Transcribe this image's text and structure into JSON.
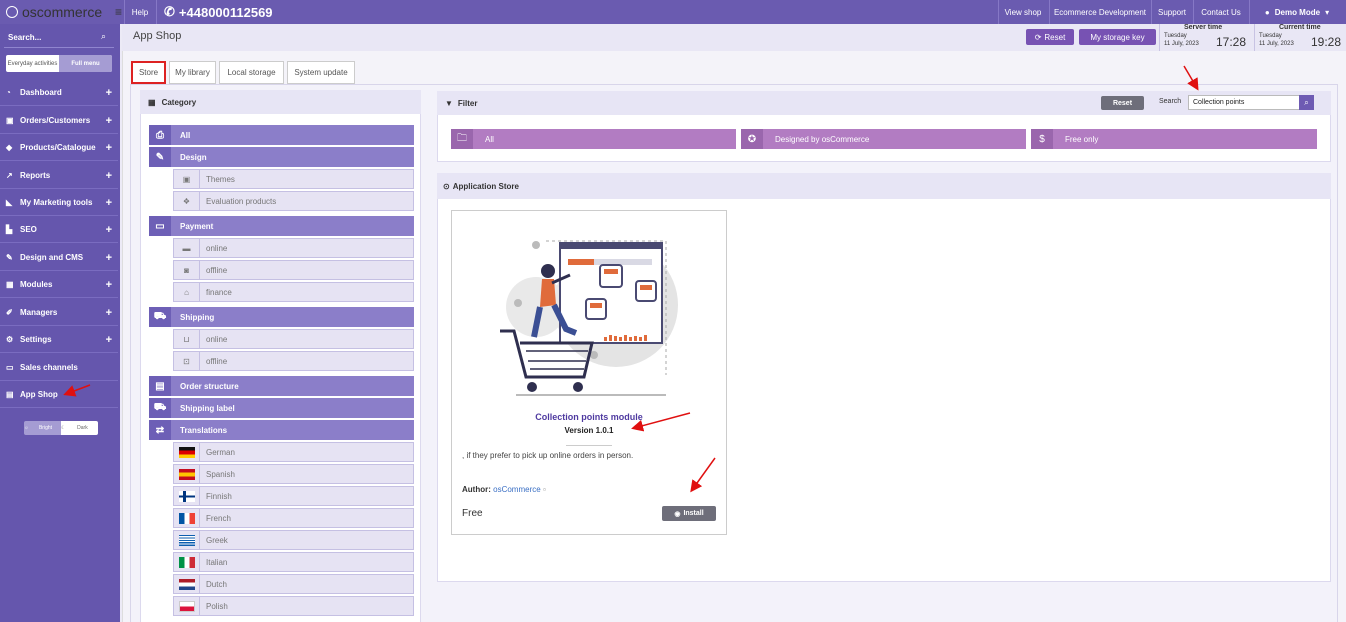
{
  "app": {
    "logo": "oscommerce",
    "help": "Help",
    "phone": "+448000112569"
  },
  "topnav": {
    "view_shop": "View shop",
    "ecommerce_dev": "Ecommerce Development",
    "support": "Support",
    "contact_us": "Contact Us",
    "demo_mode": "Demo Mode"
  },
  "sidebar": {
    "search_placeholder": "Search...",
    "toggle": {
      "everyday": "Everyday activities",
      "full": "Full menu"
    },
    "items": [
      {
        "label": "Dashboard",
        "icon": "dashboard-icon",
        "glyph": "◔"
      },
      {
        "label": "Orders/Customers",
        "icon": "cart-icon",
        "glyph": "▣"
      },
      {
        "label": "Products/Catalogue",
        "icon": "tag-icon",
        "glyph": "◆"
      },
      {
        "label": "Reports",
        "icon": "chart-icon",
        "glyph": "↗"
      },
      {
        "label": "My Marketing tools",
        "icon": "megaphone-icon",
        "glyph": "◣"
      },
      {
        "label": "SEO",
        "icon": "bars-icon",
        "glyph": "▙"
      },
      {
        "label": "Design and CMS",
        "icon": "brush-icon",
        "glyph": "✎"
      },
      {
        "label": "Modules",
        "icon": "cubes-icon",
        "glyph": "▦"
      },
      {
        "label": "Managers",
        "icon": "pencil-icon",
        "glyph": "✐"
      },
      {
        "label": "Settings",
        "icon": "gears-icon",
        "glyph": "⚙"
      },
      {
        "label": "Sales channels",
        "icon": "monitor-icon",
        "glyph": "▭"
      },
      {
        "label": "App Shop",
        "icon": "shop-icon",
        "glyph": "▤"
      }
    ],
    "theme": {
      "bright": "Bright",
      "dark": "Dark"
    }
  },
  "header": {
    "title": "App Shop",
    "reset": "Reset",
    "storage_key": "My storage key",
    "server_time": {
      "label": "Server time",
      "day": "Tuesday",
      "date": "11 July, 2023",
      "time": "17:28"
    },
    "current_time": {
      "label": "Current time",
      "day": "Tuesday",
      "date": "11 July, 2023",
      "time": "19:28"
    }
  },
  "tabs": [
    "Store",
    "My library",
    "Local storage",
    "System update"
  ],
  "category": {
    "title": "Category",
    "all": "All",
    "design": "Design",
    "themes": "Themes",
    "evaluation": "Evaluation products",
    "payment": "Payment",
    "pay_online": "online",
    "pay_offline": "offline",
    "finance": "finance",
    "shipping": "Shipping",
    "ship_online": "online",
    "ship_offline": "offline",
    "order_structure": "Order structure",
    "shipping_label": "Shipping label",
    "translations": "Translations",
    "languages": [
      "German",
      "Spanish",
      "Finnish",
      "French",
      "Greek",
      "Italian",
      "Dutch",
      "Polish"
    ]
  },
  "filter": {
    "title": "Filter",
    "reset": "Reset",
    "search_label": "Search",
    "search_value": "Collection points",
    "all": "All",
    "designed_by": "Designed by osCommerce",
    "free_only": "Free only"
  },
  "store": {
    "title": "Application Store",
    "app": {
      "name": "Collection points module",
      "version": "Version 1.0.1",
      "description": ", if they prefer to pick up online orders in person.",
      "author_label": "Author:",
      "author": "osCommerce",
      "price": "Free",
      "install": "Install"
    }
  },
  "colors": {
    "brand": "#6a5bb0",
    "accent": "#7752b3",
    "filter": "#b27cc2",
    "category": "#8b7ec9"
  }
}
